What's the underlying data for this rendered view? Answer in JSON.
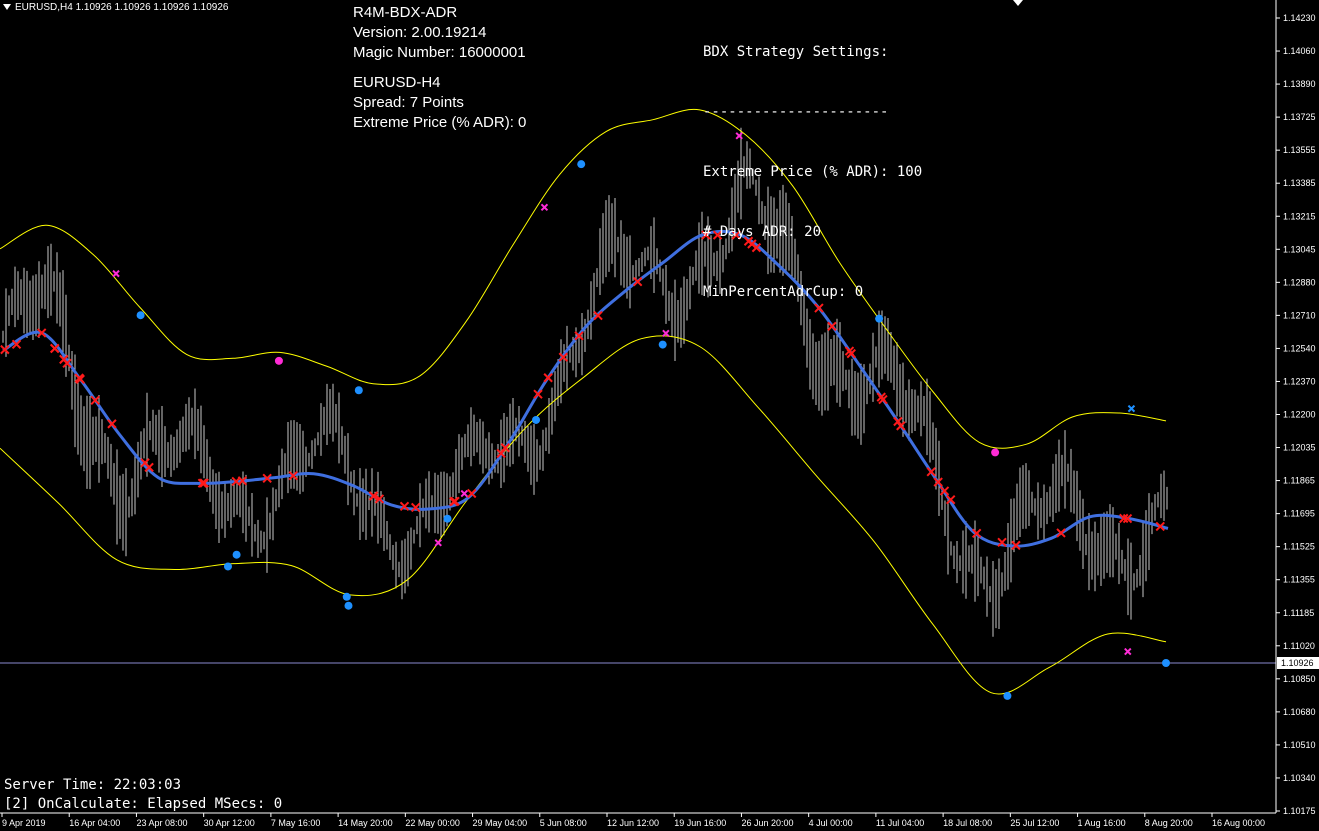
{
  "header": {
    "symbol_line": "EURUSD,H4  1.10926 1.10926 1.10926 1.10926"
  },
  "ea_info": {
    "name": "R4M-BDX-ADR",
    "version": "Version: 2.00.19214",
    "magic": "Magic Number: 16000001",
    "symbol": "EURUSD-H4",
    "spread": "Spread: 7 Points",
    "extreme": "Extreme Price (% ADR): 0"
  },
  "settings": {
    "title": "BDX Strategy Settings:",
    "divider": "----------------------",
    "extreme": "Extreme Price (% ADR): 100",
    "days": "# Days ADR: 20",
    "min_cup": "MinPercentAdrCup: 0"
  },
  "footer": {
    "server_time": "Server Time: 22:03:03",
    "elapsed": "[2] OnCalculate: Elapsed MSecs: 0"
  },
  "colors": {
    "background": "#000000",
    "midline": "#3f6fe0",
    "bands": "#ffff00",
    "red_marker": "#ff1a1a",
    "blue_marker": "#1e90ff",
    "magenta_marker": "#ff2bd6",
    "bars": "#c8c8c8",
    "price_line": "#8a8ad0"
  },
  "chart_data": {
    "type": "line",
    "symbol": "EURUSD",
    "timeframe": "H4",
    "current_price": "1.10926",
    "y_range": [
      1.10175,
      1.1423
    ],
    "y_ticks": [
      "1.14230",
      "1.14060",
      "1.13890",
      "1.13725",
      "1.13555",
      "1.13385",
      "1.13215",
      "1.13045",
      "1.12880",
      "1.12710",
      "1.12540",
      "1.12370",
      "1.12200",
      "1.12035",
      "1.11865",
      "1.11695",
      "1.11525",
      "1.11355",
      "1.11185",
      "1.11020",
      "1.10850",
      "1.10680",
      "1.10510",
      "1.10340",
      "1.10175"
    ],
    "x_ticks": [
      "9 Apr 2019",
      "16 Apr 04:00",
      "23 Apr 08:00",
      "30 Apr 12:00",
      "7 May 16:00",
      "14 May 20:00",
      "22 May 00:00",
      "29 May 04:00",
      "5 Jun 08:00",
      "12 Jun 12:00",
      "19 Jun 16:00",
      "26 Jun 20:00",
      "4 Jul 00:00",
      "11 Jul 04:00",
      "18 Jul 08:00",
      "25 Jul 12:00",
      "1 Aug 16:00",
      "8 Aug 20:00",
      "16 Aug 00:00"
    ],
    "series_mid": [
      1.1253,
      1.1262,
      1.1238,
      1.121,
      1.1188,
      1.1185,
      1.1186,
      1.1188,
      1.119,
      1.1184,
      1.1174,
      1.1172,
      1.1178,
      1.1205,
      1.1238,
      1.1265,
      1.1283,
      1.1298,
      1.1312,
      1.1312,
      1.1296,
      1.1275,
      1.1247,
      1.1218,
      1.1188,
      1.116,
      1.1153,
      1.1157,
      1.1168,
      1.1167,
      1.1162
    ],
    "series_upper": [
      1.1305,
      1.1317,
      1.1302,
      1.1275,
      1.1251,
      1.1249,
      1.1252,
      1.1245,
      1.1236,
      1.124,
      1.1268,
      1.1307,
      1.1343,
      1.1365,
      1.1371,
      1.1376,
      1.1363,
      1.1337,
      1.1298,
      1.1264,
      1.1232,
      1.1206,
      1.1205,
      1.1219,
      1.1221,
      1.1217
    ],
    "series_lower": [
      1.1203,
      1.1175,
      1.1146,
      1.1141,
      1.1144,
      1.1143,
      1.1128,
      1.1136,
      1.1176,
      1.1213,
      1.1239,
      1.1259,
      1.1255,
      1.1224,
      1.1189,
      1.1155,
      1.1113,
      1.1078,
      1.1091,
      1.1108,
      1.1104
    ]
  }
}
